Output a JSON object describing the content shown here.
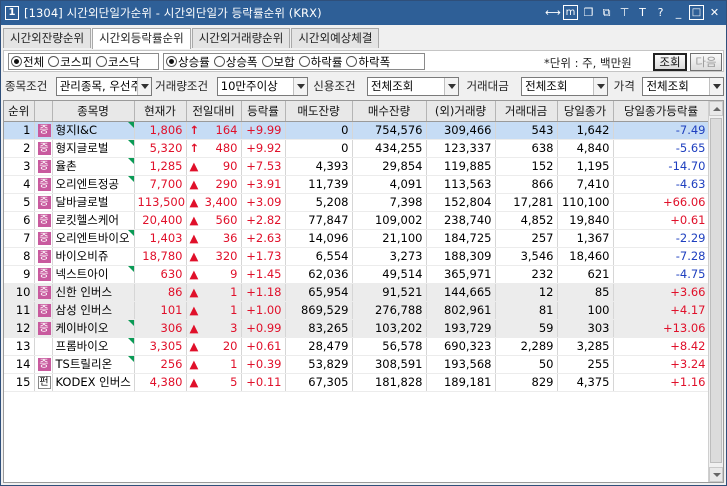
{
  "window": {
    "number": "1",
    "title": "[1304] 시간외단일가순위 - 시간외단일가 등락률순위 (KRX)",
    "icons": [
      "m-icon",
      "link-icon",
      "restore-icon",
      "pin-icon",
      "text-icon",
      "help-icon",
      "minimize-icon",
      "maximize-icon",
      "close-icon"
    ]
  },
  "tabs": [
    {
      "label": "시간외잔량순위",
      "active": false
    },
    {
      "label": "시간외등락률순위",
      "active": true
    },
    {
      "label": "시간외거래량순위",
      "active": false
    },
    {
      "label": "시간외예상체결",
      "active": false
    }
  ],
  "market_options": [
    {
      "label": "전체",
      "selected": true
    },
    {
      "label": "코스피",
      "selected": false
    },
    {
      "label": "코스닥",
      "selected": false
    }
  ],
  "rank_options": [
    {
      "label": "상승률",
      "selected": true
    },
    {
      "label": "상승폭",
      "selected": false
    },
    {
      "label": "보합",
      "selected": false
    },
    {
      "label": "하락률",
      "selected": false
    },
    {
      "label": "하락폭",
      "selected": false
    }
  ],
  "unit_text": "*단위 : 주, 백만원",
  "buttons": {
    "search": "조회",
    "next": "다음"
  },
  "conditions": {
    "stock_label": "종목조건",
    "stock_value": "관리종목, 우선주",
    "volume_label": "거래량조건",
    "volume_value": "10만주이상",
    "credit_label": "신용조건",
    "credit_value": "전체조회",
    "amount_label": "거래대금",
    "amount_value": "전체조회",
    "price_label": "가격",
    "price_value": "전체조회"
  },
  "table": {
    "columns": [
      "순위",
      "",
      "종목명",
      "현재가",
      "전일대비",
      "등락률",
      "매도잔량",
      "매수잔량",
      "(외)거래량",
      "거래대금",
      "당일종가",
      "당일종가등락률"
    ],
    "rows": [
      {
        "rank": "1",
        "badge": "증",
        "badge_color": "#c85a9e",
        "name": "형지I&C",
        "flag": true,
        "price": "1,806",
        "arrow": "↑",
        "change": "164",
        "rate": "+9.99",
        "ask": "0",
        "bid": "754,576",
        "volume": "309,466",
        "amount": "543",
        "close": "1,642",
        "close_rate": "-7.49",
        "close_dir": "down",
        "selected": true
      },
      {
        "rank": "2",
        "badge": "증",
        "badge_color": "#c85a9e",
        "name": "형지글로벌",
        "flag": true,
        "price": "5,320",
        "arrow": "↑",
        "change": "480",
        "rate": "+9.92",
        "ask": "0",
        "bid": "434,255",
        "volume": "123,337",
        "amount": "638",
        "close": "4,840",
        "close_rate": "-5.65",
        "close_dir": "down"
      },
      {
        "rank": "3",
        "badge": "증",
        "badge_color": "#c85a9e",
        "name": "율촌",
        "flag": true,
        "price": "1,285",
        "arrow": "▲",
        "change": "90",
        "rate": "+7.53",
        "ask": "4,393",
        "bid": "29,854",
        "volume": "119,885",
        "amount": "152",
        "close": "1,195",
        "close_rate": "-14.70",
        "close_dir": "down"
      },
      {
        "rank": "4",
        "badge": "증",
        "badge_color": "#c85a9e",
        "name": "오리엔트정공",
        "flag": true,
        "price": "7,700",
        "arrow": "▲",
        "change": "290",
        "rate": "+3.91",
        "ask": "11,739",
        "bid": "4,091",
        "volume": "113,563",
        "amount": "866",
        "close": "7,410",
        "close_rate": "-4.63",
        "close_dir": "down"
      },
      {
        "rank": "5",
        "badge": "증",
        "badge_color": "#c85a9e",
        "name": "달바글로벌",
        "flag": false,
        "price": "113,500",
        "arrow": "▲",
        "change": "3,400",
        "rate": "+3.09",
        "ask": "5,208",
        "bid": "7,398",
        "volume": "152,804",
        "amount": "17,281",
        "close": "110,100",
        "close_rate": "+66.06",
        "close_dir": "up"
      },
      {
        "rank": "6",
        "badge": "증",
        "badge_color": "#c85a9e",
        "name": "로킷헬스케어",
        "flag": false,
        "price": "20,400",
        "arrow": "▲",
        "change": "560",
        "rate": "+2.82",
        "ask": "77,847",
        "bid": "109,002",
        "volume": "238,740",
        "amount": "4,852",
        "close": "19,840",
        "close_rate": "+0.61",
        "close_dir": "up"
      },
      {
        "rank": "7",
        "badge": "증",
        "badge_color": "#c85a9e",
        "name": "오리엔트바이오",
        "flag": true,
        "price": "1,403",
        "arrow": "▲",
        "change": "36",
        "rate": "+2.63",
        "ask": "14,096",
        "bid": "21,100",
        "volume": "184,725",
        "amount": "257",
        "close": "1,367",
        "close_rate": "-2.29",
        "close_dir": "down"
      },
      {
        "rank": "8",
        "badge": "증",
        "badge_color": "#c85a9e",
        "name": "바이오비쥬",
        "flag": false,
        "price": "18,780",
        "arrow": "▲",
        "change": "320",
        "rate": "+1.73",
        "ask": "6,554",
        "bid": "3,273",
        "volume": "188,309",
        "amount": "3,546",
        "close": "18,460",
        "close_rate": "-7.28",
        "close_dir": "down"
      },
      {
        "rank": "9",
        "badge": "증",
        "badge_color": "#c85a9e",
        "name": "넥스트아이",
        "flag": true,
        "price": "630",
        "arrow": "▲",
        "change": "9",
        "rate": "+1.45",
        "ask": "62,036",
        "bid": "49,514",
        "volume": "365,971",
        "amount": "232",
        "close": "621",
        "close_rate": "-4.75",
        "close_dir": "down"
      },
      {
        "rank": "10",
        "badge": "증",
        "badge_color": "#c85a9e",
        "name": "신한 인버스",
        "flag": false,
        "price": "86",
        "arrow": "▲",
        "change": "1",
        "rate": "+1.18",
        "ask": "65,954",
        "bid": "91,521",
        "volume": "144,665",
        "amount": "12",
        "close": "85",
        "close_rate": "+3.66",
        "close_dir": "up"
      },
      {
        "rank": "11",
        "badge": "증",
        "badge_color": "#c85a9e",
        "name": "삼성 인버스",
        "flag": false,
        "price": "101",
        "arrow": "▲",
        "change": "1",
        "rate": "+1.00",
        "ask": "869,529",
        "bid": "276,788",
        "volume": "802,961",
        "amount": "81",
        "close": "100",
        "close_rate": "+4.17",
        "close_dir": "up"
      },
      {
        "rank": "12",
        "badge": "증",
        "badge_color": "#c85a9e",
        "name": "케이바이오",
        "flag": true,
        "price": "306",
        "arrow": "▲",
        "change": "3",
        "rate": "+0.99",
        "ask": "83,265",
        "bid": "103,202",
        "volume": "193,729",
        "amount": "59",
        "close": "303",
        "close_rate": "+13.06",
        "close_dir": "up"
      },
      {
        "rank": "13",
        "badge": "",
        "badge_color": "",
        "name": "프롬바이오",
        "flag": true,
        "price": "3,305",
        "arrow": "▲",
        "change": "20",
        "rate": "+0.61",
        "ask": "28,479",
        "bid": "56,578",
        "volume": "690,323",
        "amount": "2,289",
        "close": "3,285",
        "close_rate": "+8.42",
        "close_dir": "up"
      },
      {
        "rank": "14",
        "badge": "증",
        "badge_color": "#c85a9e",
        "name": "TS트릴리온",
        "flag": true,
        "price": "256",
        "arrow": "▲",
        "change": "1",
        "rate": "+0.39",
        "ask": "53,829",
        "bid": "308,591",
        "volume": "193,568",
        "amount": "50",
        "close": "255",
        "close_rate": "+3.24",
        "close_dir": "up"
      },
      {
        "rank": "15",
        "badge": "펀",
        "badge_color": "#ffffff",
        "name": "KODEX 인버스",
        "flag": false,
        "price": "4,380",
        "arrow": "▲",
        "change": "5",
        "rate": "+0.11",
        "ask": "67,305",
        "bid": "181,828",
        "volume": "189,181",
        "amount": "829",
        "close": "4,375",
        "close_rate": "+1.16",
        "close_dir": "up"
      }
    ]
  },
  "colors": {
    "titlebar": "#2e5f97",
    "up": "#e0102a",
    "down": "#1e3fbf",
    "selected_row": "#c6dcf5",
    "alt_row": "#ececec",
    "flag": "#0a9a55"
  }
}
